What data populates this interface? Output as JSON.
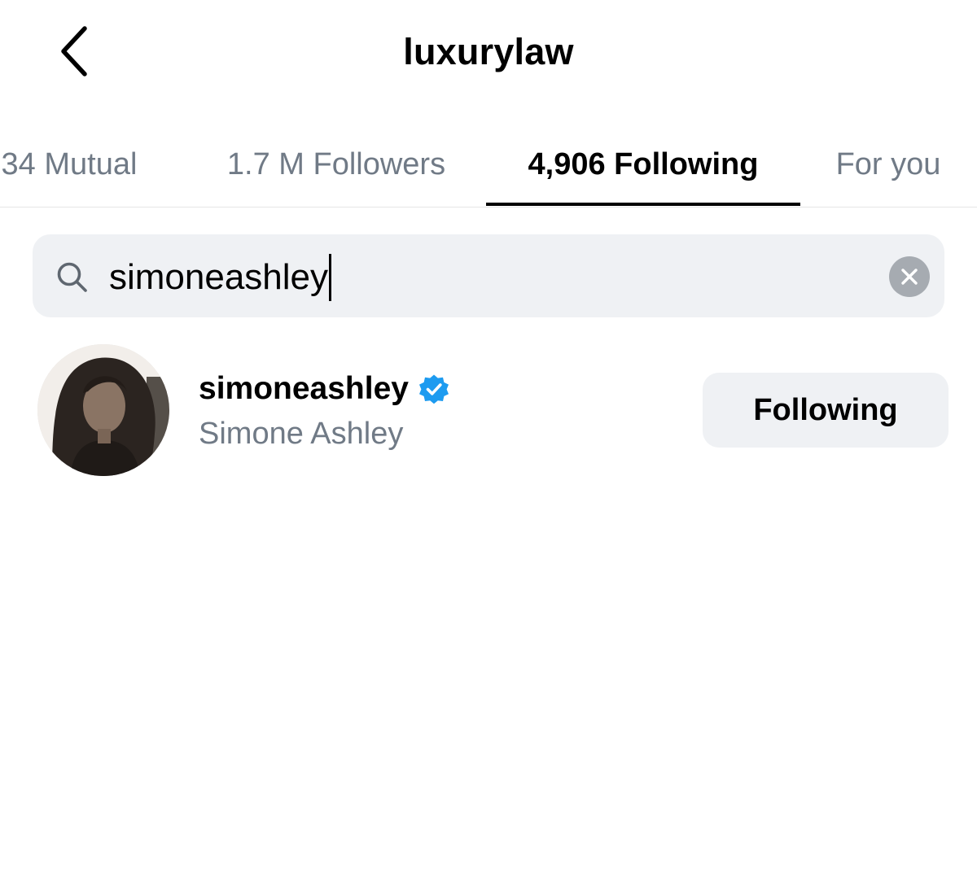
{
  "header": {
    "title": "luxurylaw",
    "back_icon": "chevron-left-icon"
  },
  "tabs": [
    {
      "label": "34 Mutual",
      "active": false
    },
    {
      "label": "1.7 M Followers",
      "active": false
    },
    {
      "label": "4,906 Following",
      "active": true
    },
    {
      "label": "For you",
      "active": false
    }
  ],
  "search": {
    "value": "simoneashley",
    "icon": "search-icon",
    "clear_icon": "clear-icon"
  },
  "results": [
    {
      "username": "simoneashley",
      "full_name": "Simone Ashley",
      "verified": true,
      "button_label": "Following"
    }
  ],
  "colors": {
    "accent_verified": "#1d9bf0",
    "secondary_text": "#707a86",
    "pill_background": "#eff1f4"
  }
}
